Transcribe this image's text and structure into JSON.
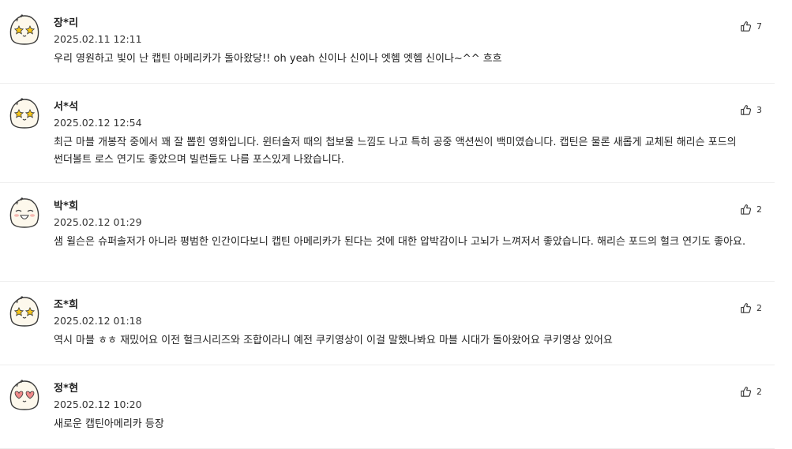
{
  "reviews": [
    {
      "avatar": "smiley-star-eyes-icon",
      "name": "장*리",
      "date": "2025.02.11 12:11",
      "text": "우리 영원하고 빛이 난 캡틴 아메리카가 돌아왔당!! oh yeah 신이나 신이나 엣헴 엣헴 신이나~^^ 흐흐",
      "likes": "7"
    },
    {
      "avatar": "smiley-star-eyes-icon",
      "name": "서*석",
      "date": "2025.02.12 12:54",
      "text": "최근 마블 개봉작 중에서 꽤 잘 뽑힌 영화입니다. 윈터솔저 때의 첩보물 느낌도 나고 특히 공중 액션씬이 백미였습니다. 캡틴은 물론 새롭게 교체된 해리슨 포드의 썬더볼트 로스 연기도 좋았으며 빌런들도 나름 포스있게 나왔습니다.",
      "likes": "3"
    },
    {
      "avatar": "smiley-laughing-icon",
      "name": "박*희",
      "date": "2025.02.12 01:29",
      "text": "샘 윌슨은 슈퍼솔저가 아니라 평범한 인간이다보니 캡틴 아메리카가 된다는 것에 대한 압박감이나 고뇌가 느껴저서 좋았습니다. 해리슨 포드의 헐크 연기도 좋아요.",
      "likes": "2"
    },
    {
      "avatar": "smiley-star-eyes-icon",
      "name": "조*희",
      "date": "2025.02.12 01:18",
      "text": "역시 마블 ㅎㅎ 재밌어요 이전 헐크시리즈와 조합이라니 예전 쿠키영상이 이걸 말했나봐요 마블 시대가 돌아왔어요 쿠키영상 있어요",
      "likes": "2"
    },
    {
      "avatar": "smiley-heart-eyes-icon",
      "name": "정*현",
      "date": "2025.02.12 10:20",
      "text": "새로운 캡틴아메리카 등장",
      "likes": "2"
    }
  ],
  "colors": {
    "avatar_face": "#fdf8ec",
    "avatar_outline": "#3a3a3a",
    "star": "#f5c518",
    "heart": "#f08a8a",
    "blush": "#f6b8b0",
    "divider": "#eeeeee"
  }
}
